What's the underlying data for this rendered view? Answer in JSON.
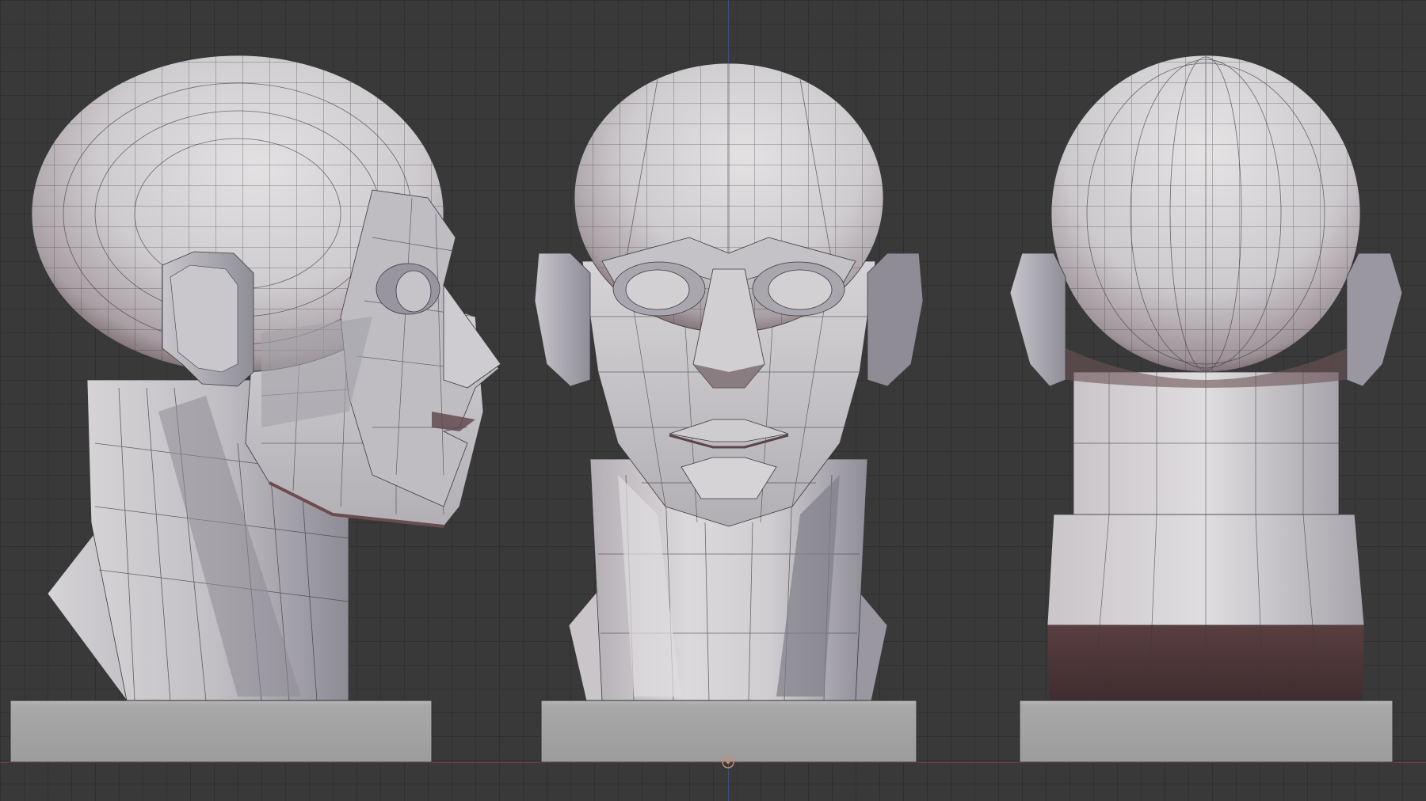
{
  "viewport": {
    "view": "orthographic",
    "background": "#393939",
    "grid_color": "#303030",
    "axis_x_color": "#7a3b45",
    "axis_y_color": "#3a4f7a"
  },
  "objects": [
    {
      "name": "head-side",
      "view": "side"
    },
    {
      "name": "head-front",
      "view": "front"
    },
    {
      "name": "head-back",
      "view": "back"
    }
  ],
  "mesh": {
    "surface_light": "#d9d6d8",
    "surface_mid": "#b9b8bd",
    "surface_shadow": "#8d8a92",
    "shadow_warm": "#5a4446",
    "wire": "#3a3a3f",
    "pedestal": "#a6a6a6"
  }
}
